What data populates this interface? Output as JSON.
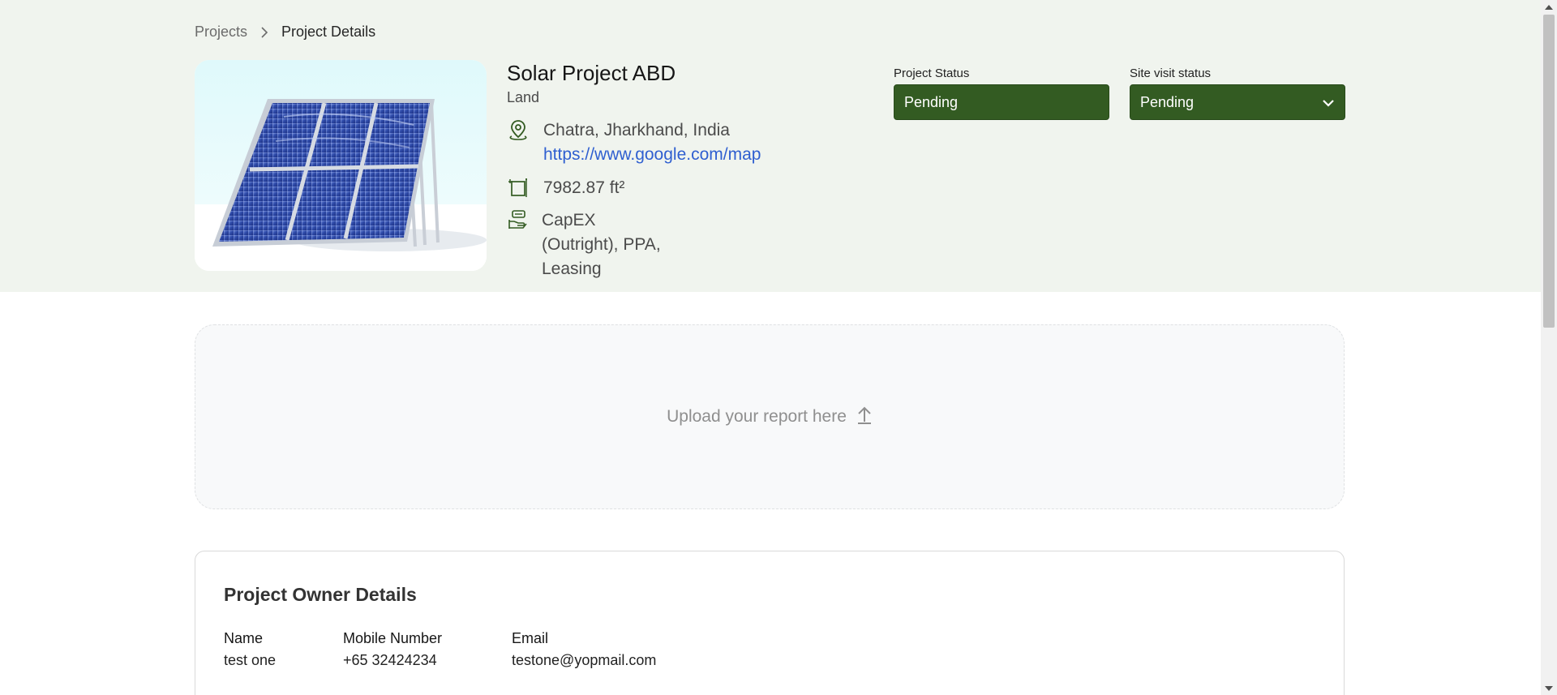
{
  "breadcrumb": {
    "parent": "Projects",
    "current": "Project Details",
    "separator_icon": "chevron-right-icon"
  },
  "project": {
    "image_alt": "solar-panel-image",
    "title": "Solar Project ABD",
    "type": "Land",
    "location": "Chatra, Jharkhand, India",
    "map_link": "https://www.google.com/map",
    "area": "7982.87 ft²",
    "financing": "CapEX (Outright), PPA, Leasing",
    "icons": [
      "location-pin-icon",
      "area-icon",
      "finance-icon"
    ]
  },
  "project_status": {
    "label": "Project Status",
    "value": "Pending"
  },
  "site_visit_status": {
    "label": "Site visit status",
    "value": "Pending",
    "icon": "chevron-down-icon"
  },
  "upload": {
    "label": "Upload your report here",
    "icon": "upload-arrow-icon"
  },
  "owner": {
    "title": "Project Owner Details",
    "columns": [
      {
        "header": "Name",
        "value": "test one"
      },
      {
        "header": "Mobile Number",
        "value": "+65 32424234"
      },
      {
        "header": "Email",
        "value": "testone@yopmail.com"
      }
    ]
  },
  "colors": {
    "accent_green": "#335b22",
    "band_background": "#f0f4ee",
    "link_blue": "#2f5fd0"
  }
}
